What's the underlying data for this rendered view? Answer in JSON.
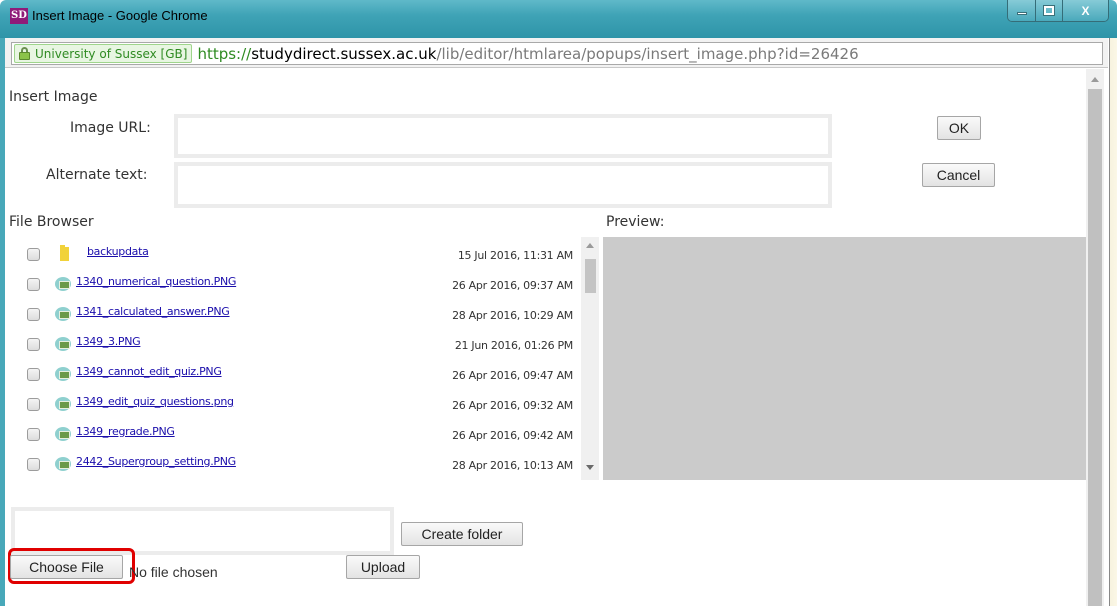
{
  "window": {
    "app_icon": "SD",
    "title": "Insert Image - Google Chrome",
    "controls": {
      "minimize": "minimize-icon",
      "maximize": "maximize-icon",
      "close": "X"
    }
  },
  "addressbar": {
    "ev_label": "University of Sussex [GB]",
    "url_scheme": "https://",
    "url_host": "studydirect.sussex.ac.uk",
    "url_path": "/lib/editor/htmlarea/popups/insert_image.php?id=26426"
  },
  "form": {
    "heading": "Insert Image",
    "image_url_label": "Image URL:",
    "image_url_value": "",
    "alt_text_label": "Alternate text:",
    "alt_text_value": "",
    "ok_label": "OK",
    "cancel_label": "Cancel"
  },
  "file_browser": {
    "heading": "File Browser",
    "preview_label": "Preview:",
    "files": [
      {
        "type": "folder",
        "name": "backupdata",
        "date": "15 Jul 2016, 11:31 AM",
        "checked": false
      },
      {
        "type": "image",
        "name": "1340_numerical_question.PNG",
        "date": "26 Apr 2016, 09:37 AM",
        "checked": false
      },
      {
        "type": "image",
        "name": "1341_calculated_answer.PNG",
        "date": "28 Apr 2016, 10:29 AM",
        "checked": false
      },
      {
        "type": "image",
        "name": "1349_3.PNG",
        "date": "21 Jun 2016, 01:26 PM",
        "checked": false
      },
      {
        "type": "image",
        "name": "1349_cannot_edit_quiz.PNG",
        "date": "26 Apr 2016, 09:47 AM",
        "checked": false
      },
      {
        "type": "image",
        "name": "1349_edit_quiz_questions.png",
        "date": "26 Apr 2016, 09:32 AM",
        "checked": false
      },
      {
        "type": "image",
        "name": "1349_regrade.PNG",
        "date": "26 Apr 2016, 09:42 AM",
        "checked": false
      },
      {
        "type": "image",
        "name": "2442_Supergroup_setting.PNG",
        "date": "28 Apr 2016, 10:13 AM",
        "checked": false
      }
    ]
  },
  "actions": {
    "folder_name_value": "",
    "create_folder_label": "Create folder",
    "choose_file_label": "Choose File",
    "no_file_text": "No file chosen",
    "upload_label": "Upload"
  },
  "colors": {
    "highlight": "#e00000",
    "link": "#1a0dab",
    "titlebar": "#3fa3b6",
    "ev_green": "#2f8b22"
  }
}
